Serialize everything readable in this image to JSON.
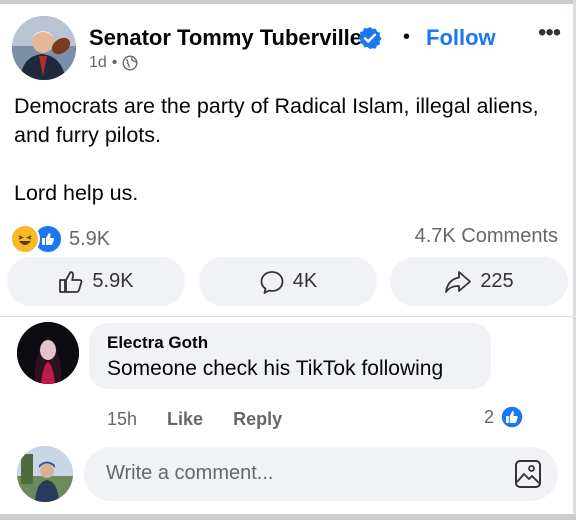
{
  "post": {
    "author": "Senator Tommy Tuberville",
    "follow_label": "Follow",
    "separator": "•",
    "more_label": "•••",
    "time": "1d",
    "time_separator": "•",
    "lines": [
      "Democrats are the party of Radical Islam, illegal aliens,",
      "and furry pilots."
    ],
    "line2": "Lord help us.",
    "reaction_count": "5.9K",
    "comments_count": "4.7K Comments"
  },
  "actions": {
    "like_count": "5.9K",
    "comment_count": "4K",
    "share_count": "225"
  },
  "comment": {
    "author": "Electra Goth",
    "text": "Someone check his TikTok following",
    "time": "15h",
    "like_label": "Like",
    "reply_label": "Reply",
    "reaction_count": "2"
  },
  "composer": {
    "placeholder": "Write a comment..."
  },
  "icons": {
    "verified": "verified-badge-icon",
    "globe": "globe-icon",
    "like": "thumbs-up-icon",
    "comment": "speech-bubble-icon",
    "share": "share-arrow-icon",
    "photo": "photo-icon"
  },
  "colors": {
    "accent": "#1877f2",
    "secondary_text": "#65676b",
    "surface": "#f0f2f5"
  }
}
